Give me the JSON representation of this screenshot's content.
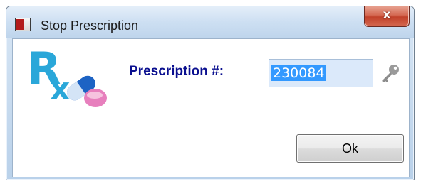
{
  "window": {
    "title": "Stop Prescription",
    "close_glyph": "x"
  },
  "form": {
    "label": "Prescription #:",
    "prescription_number": "230084",
    "ok_label": "Ok"
  },
  "icons": {
    "app": "app-window-icon",
    "logo": "rx-pills-icon",
    "lookup": "key-icon"
  },
  "colors": {
    "label_text": "#0a0f8f",
    "selection": "#3399ff",
    "close_button": "#c1412a",
    "rx_logo": "#2aa7d9"
  }
}
